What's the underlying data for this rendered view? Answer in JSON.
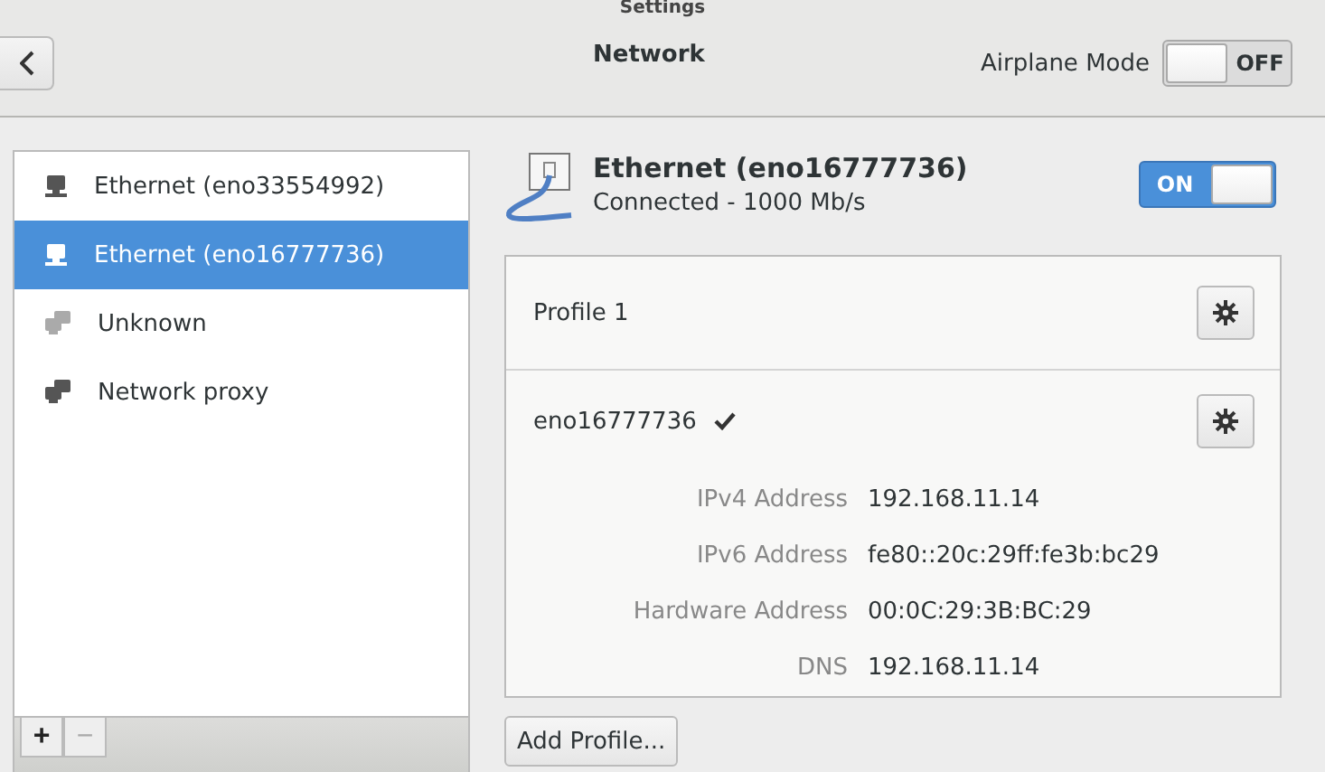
{
  "window": {
    "title": "Settings"
  },
  "header": {
    "title": "Network",
    "airplane_mode": {
      "label": "Airplane Mode",
      "on": false,
      "text": "OFF"
    }
  },
  "sidebar": {
    "items": [
      {
        "label": "Ethernet (eno33554992)",
        "kind": "wired",
        "selected": false
      },
      {
        "label": "Ethernet (eno16777736)",
        "kind": "wired",
        "selected": true
      },
      {
        "label": "Unknown",
        "kind": "unknown",
        "selected": false
      },
      {
        "label": "Network proxy",
        "kind": "proxy",
        "selected": false
      }
    ],
    "toolbar": [
      {
        "label": "+",
        "disabled": false
      },
      {
        "label": "−",
        "disabled": true
      }
    ]
  },
  "device": {
    "name": "Ethernet (eno16777736)",
    "status": "Connected - 1000 Mb/s",
    "switch": {
      "on": true,
      "text": "ON"
    }
  },
  "profiles": [
    {
      "name": "Profile 1",
      "active": false
    },
    {
      "name": "eno16777736",
      "active": true,
      "details": [
        {
          "label": "IPv4 Address",
          "value": "192.168.11.14"
        },
        {
          "label": "IPv6 Address",
          "value": "fe80::20c:29ff:fe3b:bc29"
        },
        {
          "label": "Hardware Address",
          "value": "00:0C:29:3B:BC:29"
        },
        {
          "label": "DNS",
          "value": "192.168.11.14"
        }
      ]
    }
  ],
  "add_profile": "Add Profile..."
}
